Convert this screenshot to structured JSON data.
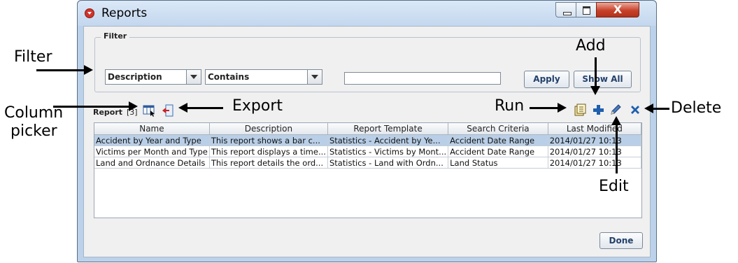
{
  "window": {
    "title": "Reports",
    "close_glyph": "X"
  },
  "filter": {
    "legend": "Filter",
    "column_select": "Description",
    "operator_select": "Contains",
    "value": "",
    "apply_label": "Apply",
    "show_all_label": "Show All"
  },
  "report": {
    "label": "Report",
    "count": "[3]"
  },
  "table": {
    "columns": [
      "Name",
      "Description",
      "Report Template",
      "Search Criteria",
      "Last Modified"
    ],
    "rows": [
      [
        "Accident by Year and Type",
        "This report shows a bar c...",
        "Statistics - Accident by Ye...",
        "Accident Date Range",
        "2014/01/27 10:13"
      ],
      [
        "Victims per Month and Type",
        "This report displays a time...",
        "Statistics - Victims by Mont...",
        "Accident Date Range",
        "2014/01/27 10:13"
      ],
      [
        "Land and Ordnance Details",
        "This report details the ord...",
        "Statistics - Land with Ordn...",
        "Land Status",
        "2014/01/27 10:13"
      ]
    ],
    "selected_row": 0
  },
  "done_label": "Done",
  "annotations": {
    "filter": "Filter",
    "column_picker_1": "Column",
    "column_picker_2": "picker",
    "export": "Export",
    "add": "Add",
    "run": "Run",
    "delete": "Delete",
    "edit": "Edit"
  },
  "colors": {
    "selection": "#b9cfe7",
    "close_button": "#c8412a",
    "frame": "#bcd2ea"
  },
  "icons": [
    "column-picker-icon",
    "export-icon",
    "run-icon",
    "add-icon",
    "edit-icon",
    "delete-icon"
  ]
}
